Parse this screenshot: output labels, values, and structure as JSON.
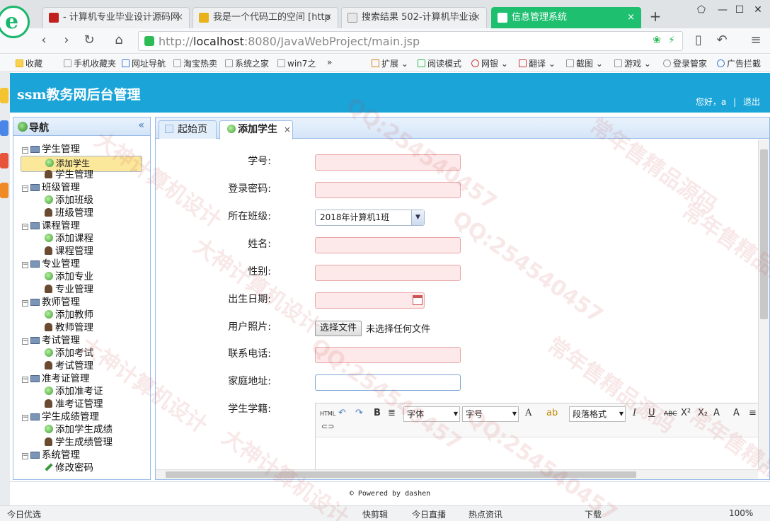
{
  "browser": {
    "tabs": [
      {
        "label": "- 计算机专业毕业设计源码网",
        "fav_color": "#c0201e"
      },
      {
        "label": "我是一个代码工的空间 [http",
        "fav_color": "#e8b21a"
      },
      {
        "label": "搜索结果 502-计算机毕业设",
        "fav_color": "#e7e7e7"
      },
      {
        "label": "信息管理系统",
        "fav_color": "#ffffff"
      }
    ],
    "url_prefix": "http://",
    "url_host": "localhost",
    "url_rest": ":8080/JavaWebProject/main.jsp",
    "bookmarks": [
      "收藏",
      "手机收藏夹",
      "网址导航",
      "淘宝热卖",
      "系统之家",
      "win7之"
    ],
    "bookmarks_right": [
      "扩展",
      "阅读模式",
      "网银",
      "翻译",
      "截图",
      "游戏",
      "登录管家",
      "广告拦截"
    ],
    "more": "»"
  },
  "app": {
    "title": "ssm教务网后台管理",
    "greeting": "您好，a",
    "separator": "|",
    "logout": "退出",
    "footer": "© Powered by dashen"
  },
  "nav": {
    "title": "导航",
    "collapse": "«",
    "groups": [
      {
        "label": "学生管理",
        "children": [
          {
            "label": "添加学生",
            "kind": "add",
            "selected": true
          },
          {
            "label": "学生管理",
            "kind": "user"
          }
        ]
      },
      {
        "label": "班级管理",
        "children": [
          {
            "label": "添加班级",
            "kind": "add"
          },
          {
            "label": "班级管理",
            "kind": "user"
          }
        ]
      },
      {
        "label": "课程管理",
        "children": [
          {
            "label": "添加课程",
            "kind": "add"
          },
          {
            "label": "课程管理",
            "kind": "user"
          }
        ]
      },
      {
        "label": "专业管理",
        "children": [
          {
            "label": "添加专业",
            "kind": "add"
          },
          {
            "label": "专业管理",
            "kind": "user"
          }
        ]
      },
      {
        "label": "教师管理",
        "children": [
          {
            "label": "添加教师",
            "kind": "add"
          },
          {
            "label": "教师管理",
            "kind": "user"
          }
        ]
      },
      {
        "label": "考试管理",
        "children": [
          {
            "label": "添加考试",
            "kind": "add"
          },
          {
            "label": "考试管理",
            "kind": "user"
          }
        ]
      },
      {
        "label": "准考证管理",
        "children": [
          {
            "label": "添加准考证",
            "kind": "add"
          },
          {
            "label": "准考证管理",
            "kind": "user"
          }
        ]
      },
      {
        "label": "学生成绩管理",
        "children": [
          {
            "label": "添加学生成绩",
            "kind": "add"
          },
          {
            "label": "学生成绩管理",
            "kind": "user"
          }
        ]
      },
      {
        "label": "系统管理",
        "children": [
          {
            "label": "修改密码",
            "kind": "pen"
          }
        ]
      }
    ]
  },
  "content_tabs": [
    {
      "label": "起始页"
    },
    {
      "label": "添加学生",
      "close": "×"
    }
  ],
  "form": {
    "student_no": "学号:",
    "password": "登录密码:",
    "class": "所在班级:",
    "class_value": "2018年计算机1班",
    "name": "姓名:",
    "gender": "性别:",
    "birthday": "出生日期:",
    "photo": "用户照片:",
    "file_button": "选择文件",
    "file_status": "未选择任何文件",
    "phone": "联系电话:",
    "address": "家庭地址:",
    "memo": "学生学籍:"
  },
  "editor": {
    "html": "HTML",
    "bold": "B",
    "font": "字体",
    "size": "字号",
    "font_color": "A",
    "paragraph": "段落格式",
    "italic": "I",
    "underline": "U",
    "strike": "ABC",
    "superscript": "X²",
    "subscript": "X₂"
  },
  "status": [
    "今日优选",
    "快剪辑",
    "今日直播",
    "热点资讯",
    "下载",
    "100%"
  ],
  "watermark": [
    "大神计算机设计",
    "QQ:254540457",
    "常年售精品源码"
  ]
}
